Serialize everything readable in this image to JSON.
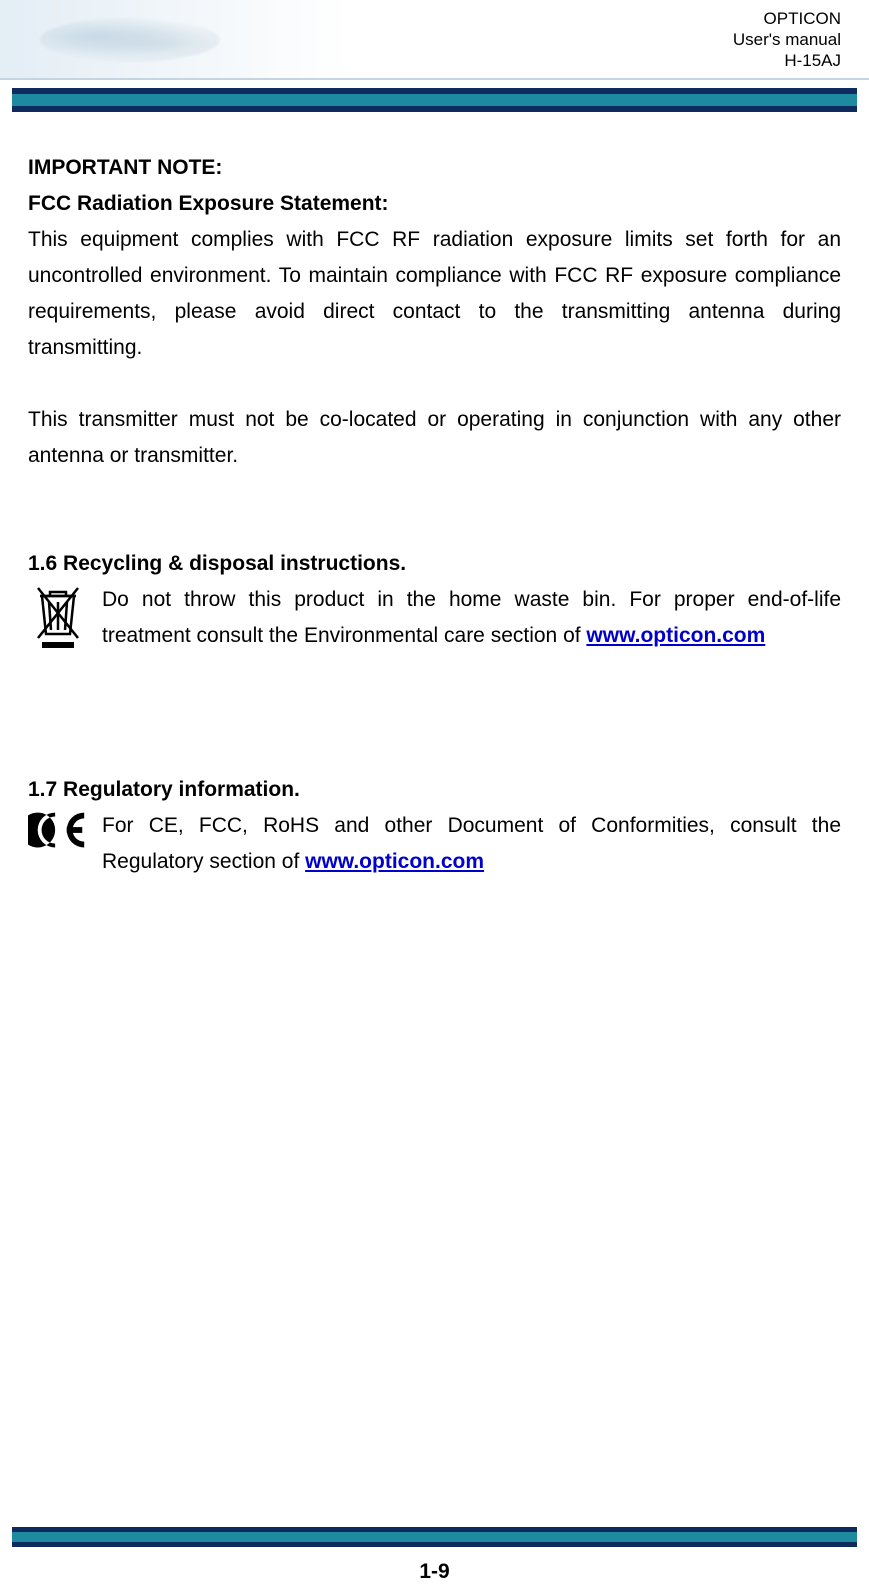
{
  "header": {
    "brand": "OPTICON",
    "subtitle": "User's manual",
    "model": "H-15AJ"
  },
  "body": {
    "imp_note_label": "IMPORTANT NOTE:",
    "fcc_heading": "FCC Radiation Exposure Statement:",
    "fcc_p1": "This equipment complies with FCC RF radiation exposure limits set forth for an uncontrolled environment. To maintain compliance with FCC RF exposure compliance requirements, please avoid direct contact to the transmitting antenna during transmitting.",
    "fcc_p2": "This transmitter must not be co-located or operating in conjunction with any other antenna or transmitter.",
    "sec16_heading": "1.6 Recycling & disposal instructions.",
    "sec16_text_pre": "Do not throw this product in the home waste bin. For proper end-of-life treatment consult the Environmental care section of ",
    "sec17_heading": "1.7 Regulatory information.",
    "sec17_text_pre": "For CE, FCC, RoHS and other Document of Conformities, consult the Regulatory section of ",
    "link_text": "www.opticon.com"
  },
  "footer": {
    "page": "1-9"
  }
}
